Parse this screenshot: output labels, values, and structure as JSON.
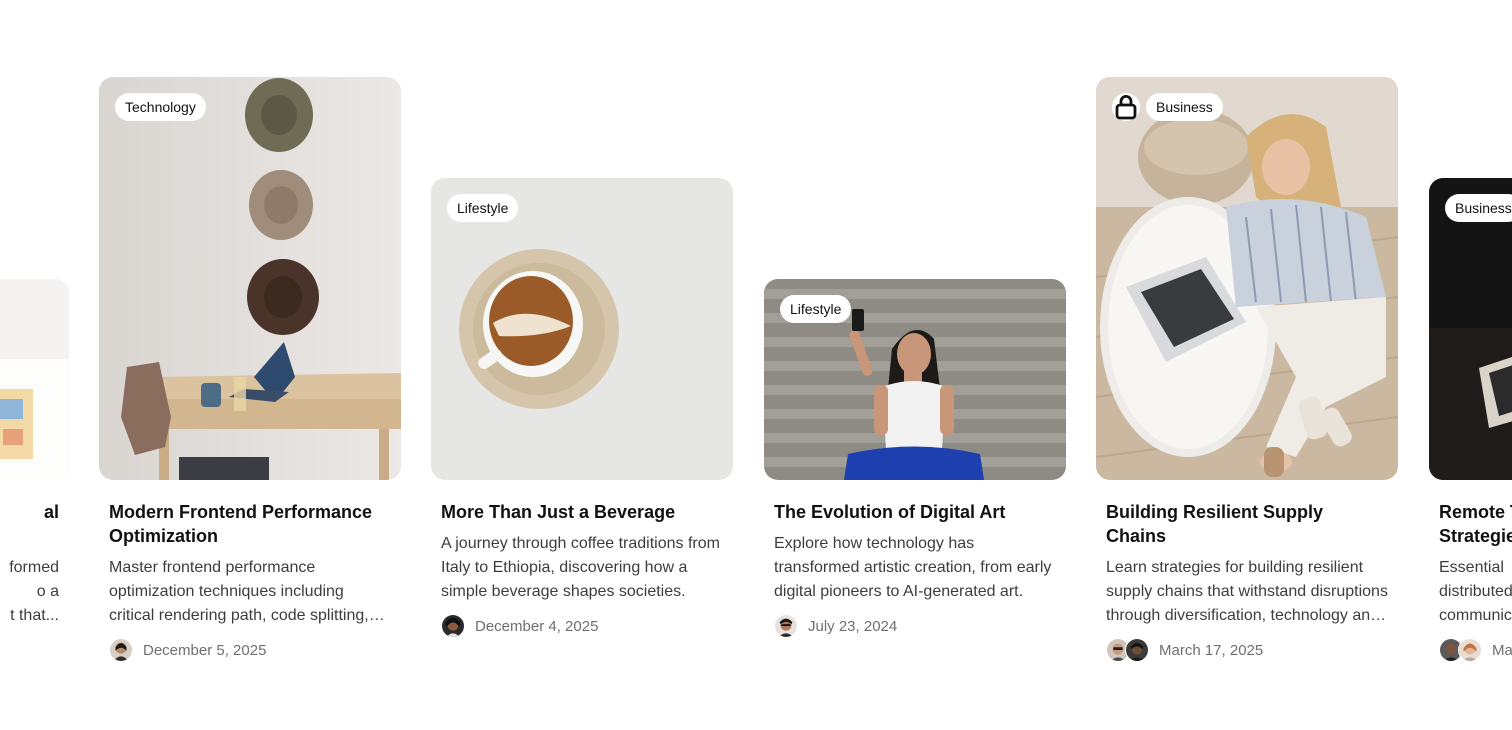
{
  "cards": [
    {
      "category": "",
      "title": "al",
      "description": "formed\no a\nt that..."
    },
    {
      "category": "Technology",
      "title": "Modern Frontend Performance Optimization",
      "description": "Master frontend performance optimization techniques including critical rendering path, code splitting, and more.",
      "date": "December 5, 2025"
    },
    {
      "category": "Lifestyle",
      "title": "More Than Just a Beverage",
      "description": "A journey through coffee traditions from Italy to Ethiopia, discovering how a simple beverage shapes societies.",
      "date": "December 4, 2025"
    },
    {
      "category": "Lifestyle",
      "title": "The Evolution of Digital Art",
      "description": "Explore how technology has transformed artistic creation, from early digital pioneers to AI-generated art.",
      "date": "July 23, 2024"
    },
    {
      "category": "Business",
      "locked": true,
      "title": "Building Resilient Supply Chains",
      "description": "Learn strategies for building resilient supply chains that withstand disruptions through diversification, technology and planning.",
      "date": "March 17, 2025"
    },
    {
      "category": "Business",
      "title": "Remote T\nStrategie",
      "description": "Essential\ndistributed\ncommunic",
      "date": "Ma"
    }
  ],
  "icons": {
    "lock": "lock-icon"
  },
  "colors": {
    "text_primary": "#111111",
    "text_secondary": "#3d3d3d",
    "text_muted": "#6f6f6f",
    "tag_bg": "#ffffff"
  }
}
